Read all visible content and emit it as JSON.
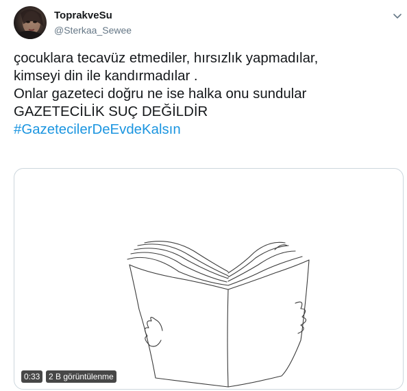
{
  "user": {
    "display_name": "ToprakveSu",
    "handle": "@Sterkaa_Sewee",
    "avatar_icon": "avatar-photo"
  },
  "menu": {
    "icon": "chevron-down-icon"
  },
  "tweet": {
    "lines": [
      "çocuklara tecavüz etmediler, hırsızlık yapmadılar,",
      "kimseyi din ile kandırmadılar .",
      "Onlar gazeteci doğru ne ise halka onu sundular",
      "GAZETECİLİK SUÇ DEĞİLDİR"
    ],
    "hashtag": "#GazetecilerDeEvdeKalsın"
  },
  "media": {
    "type": "video",
    "duration": "0:33",
    "views": "2 B görüntülenme",
    "content": "line drawing of hands holding an open newspaper"
  },
  "colors": {
    "text": "#14171a",
    "secondary": "#657786",
    "link": "#1b95e0",
    "border": "#ccd6dd"
  }
}
